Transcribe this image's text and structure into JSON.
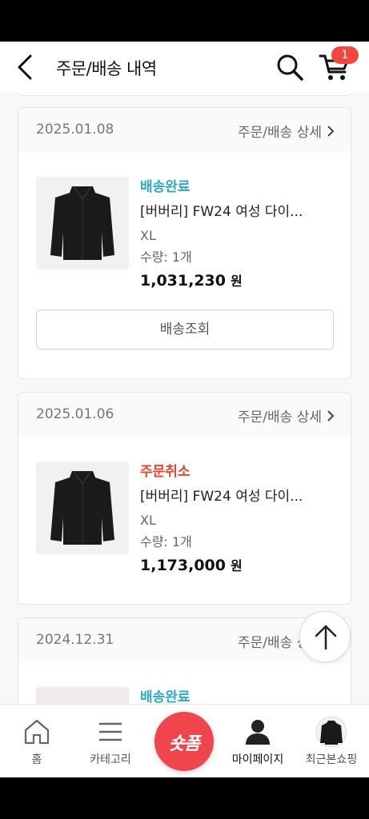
{
  "header": {
    "title": "주문/배송 내역",
    "cart_count": "1"
  },
  "orders": [
    {
      "date": "2025.01.08",
      "detail_label": "주문/배송 상세",
      "status": "배송완료",
      "product_name": "[버버리] FW24 여성 다이...",
      "option": "XL",
      "quantity": "수량: 1개",
      "price": "1,031,230",
      "currency": "원",
      "track_label": "배송조회"
    },
    {
      "date": "2025.01.06",
      "detail_label": "주문/배송 상세",
      "status": "주문취소",
      "product_name": "[버버리] FW24 여성 다이...",
      "option": "XL",
      "quantity": "수량: 1개",
      "price": "1,173,000",
      "currency": "원"
    },
    {
      "date": "2024.12.31",
      "detail_label": "주문/배송 상세",
      "status": "배송완료"
    }
  ],
  "bottom_nav": {
    "home": "홈",
    "category": "카테고리",
    "center": "숏폼",
    "mypage": "마이페이지",
    "recent": "최근본쇼핑"
  },
  "colors": {
    "status_done": "#2fa8c9",
    "status_cancel": "#e8462e",
    "badge": "#f0483e",
    "fab": "#f0454d"
  }
}
